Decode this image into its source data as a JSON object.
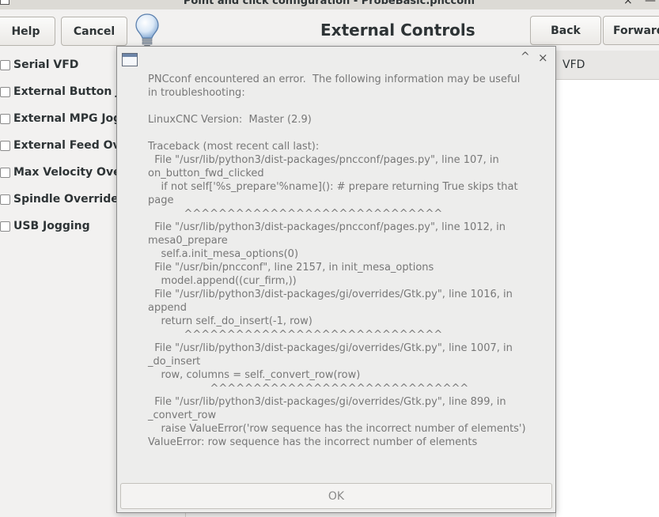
{
  "window": {
    "title": "Point and click configuration - ProbeBasic.pncconf",
    "close_glyph": "×",
    "minimize_glyph": "—"
  },
  "toolbar": {
    "help_label": "Help",
    "cancel_label": "Cancel",
    "page_title": "External Controls",
    "back_label": "Back",
    "forward_label": "Forward"
  },
  "options": [
    {
      "label": "Serial VFD"
    },
    {
      "label": "External Button Jogging"
    },
    {
      "label": "External MPG Jogging"
    },
    {
      "label": "External Feed Override"
    },
    {
      "label": "Max Velocity Override"
    },
    {
      "label": "Spindle Override"
    },
    {
      "label": "USB Jogging"
    }
  ],
  "right_tab": {
    "label": "VFD"
  },
  "dialog": {
    "collapse_glyph": "^",
    "close_glyph": "×",
    "message": "PNCconf encountered an error.  The following information may be useful\nin troubleshooting:\n\nLinuxCNC Version:  Master (2.9)\n\nTraceback (most recent call last):\n  File \"/usr/lib/python3/dist-packages/pncconf/pages.py\", line 107, in\non_button_fwd_clicked\n    if not self['%s_prepare'%name](): # prepare returning True skips that\npage\n           ^^^^^^^^^^^^^^^^^^^^^^^^^^^^^^\n  File \"/usr/lib/python3/dist-packages/pncconf/pages.py\", line 1012, in\nmesa0_prepare\n    self.a.init_mesa_options(0)\n  File \"/usr/bin/pncconf\", line 2157, in init_mesa_options\n    model.append((cur_firm,))\n  File \"/usr/lib/python3/dist-packages/gi/overrides/Gtk.py\", line 1016, in\nappend\n    return self._do_insert(-1, row)\n           ^^^^^^^^^^^^^^^^^^^^^^^^^^^^^^\n  File \"/usr/lib/python3/dist-packages/gi/overrides/Gtk.py\", line 1007, in\n_do_insert\n    row, columns = self._convert_row(row)\n                   ^^^^^^^^^^^^^^^^^^^^^^^^^^^^^^\n  File \"/usr/lib/python3/dist-packages/gi/overrides/Gtk.py\", line 899, in\n_convert_row\n    raise ValueError('row sequence has the incorrect number of elements')\nValueError: row sequence has the incorrect number of elements",
    "ok_label": "OK"
  },
  "colors": {
    "background": "#f2f1f0",
    "dialog_background": "#ededec",
    "dialog_text": "#777777",
    "bulb_yellow": "#ffffff"
  }
}
